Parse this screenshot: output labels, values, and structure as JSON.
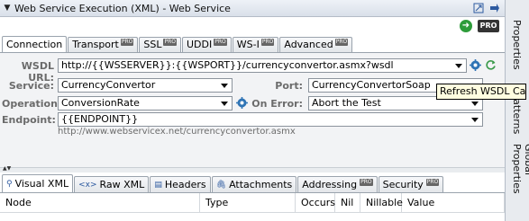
{
  "window": {
    "title": "Web Service Execution (XML) - Web Service"
  },
  "toolbar": {
    "run_icon": "green-play-icon",
    "pro_label": "PRO"
  },
  "tabs": [
    {
      "label": "Connection",
      "active": true,
      "pro": false
    },
    {
      "label": "Transport",
      "active": false,
      "pro": true
    },
    {
      "label": "SSL",
      "active": false,
      "pro": true
    },
    {
      "label": "UDDI",
      "active": false,
      "pro": true
    },
    {
      "label": "WS-I",
      "active": false,
      "pro": true
    },
    {
      "label": "Advanced",
      "active": false,
      "pro": true
    }
  ],
  "pro_mini": "PRO",
  "form": {
    "wsdl_label": "WSDL URL:",
    "wsdl_value": "http://{{WSSERVER}}:{{WSPORT}}/currencyconvertor.asmx?wsdl",
    "service_label": "Service:",
    "service_value": "CurrencyConvertor",
    "port_label": "Port:",
    "port_value": "CurrencyConvertorSoap",
    "operation_label": "Operation:",
    "operation_value": "ConversionRate",
    "onerror_label": "On Error:",
    "onerror_value": "Abort the Test",
    "endpoint_label": "Endpoint:",
    "endpoint_value": "{{ENDPOINT}}",
    "endpoint_hint": "http://www.webservicex.net/currencyconvertor.asmx"
  },
  "tooltip": "Refresh WSDL Cache",
  "bottom_tabs": [
    {
      "label": "Visual XML",
      "active": true,
      "icon": "tree-icon"
    },
    {
      "label": "Raw XML",
      "active": false,
      "icon": "xml-icon"
    },
    {
      "label": "Headers",
      "active": false,
      "icon": "soap-icon"
    },
    {
      "label": "Attachments",
      "active": false,
      "icon": "paperclip-icon"
    },
    {
      "label": "Addressing",
      "active": false,
      "icon": ""
    },
    {
      "label": "Security",
      "active": false,
      "icon": ""
    }
  ],
  "grid_columns": [
    "Node",
    "Type",
    "Occurs",
    "Nil",
    "Nillable",
    "Value"
  ],
  "side_panels": [
    "Properties",
    "Patterns",
    "Global Properties"
  ]
}
